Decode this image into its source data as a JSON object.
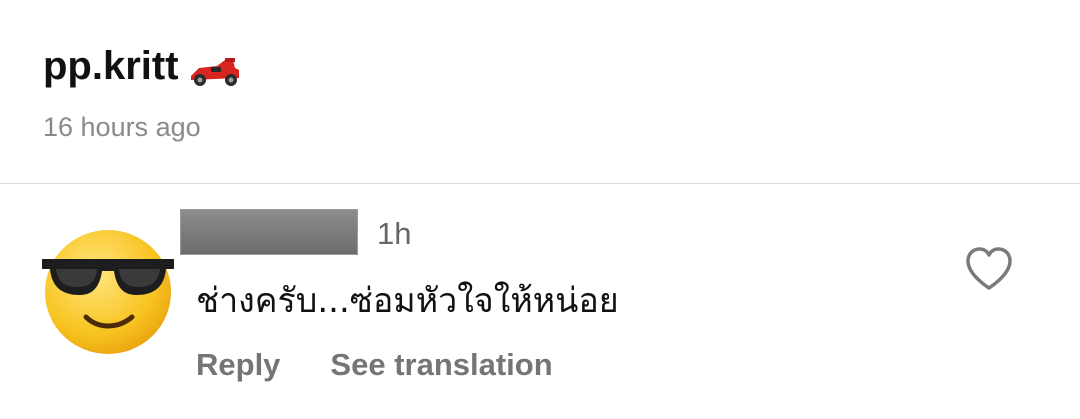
{
  "post": {
    "author": "pp.kritt",
    "author_icon": "race-car-icon",
    "time": "16 hours ago"
  },
  "comment": {
    "avatar_icon": "sunglasses-smiley-icon",
    "username": "",
    "time": "1h",
    "text": "ช่างครับ...ซ่อมหัวใจให้หน่อย",
    "actions": {
      "reply": "Reply",
      "translate": "See translation"
    },
    "like_icon": "heart-outline-icon"
  },
  "colors": {
    "primary_text": "#111111",
    "secondary_text": "#8a8a8a",
    "action_text": "#757575",
    "divider": "#dcdcdc"
  }
}
